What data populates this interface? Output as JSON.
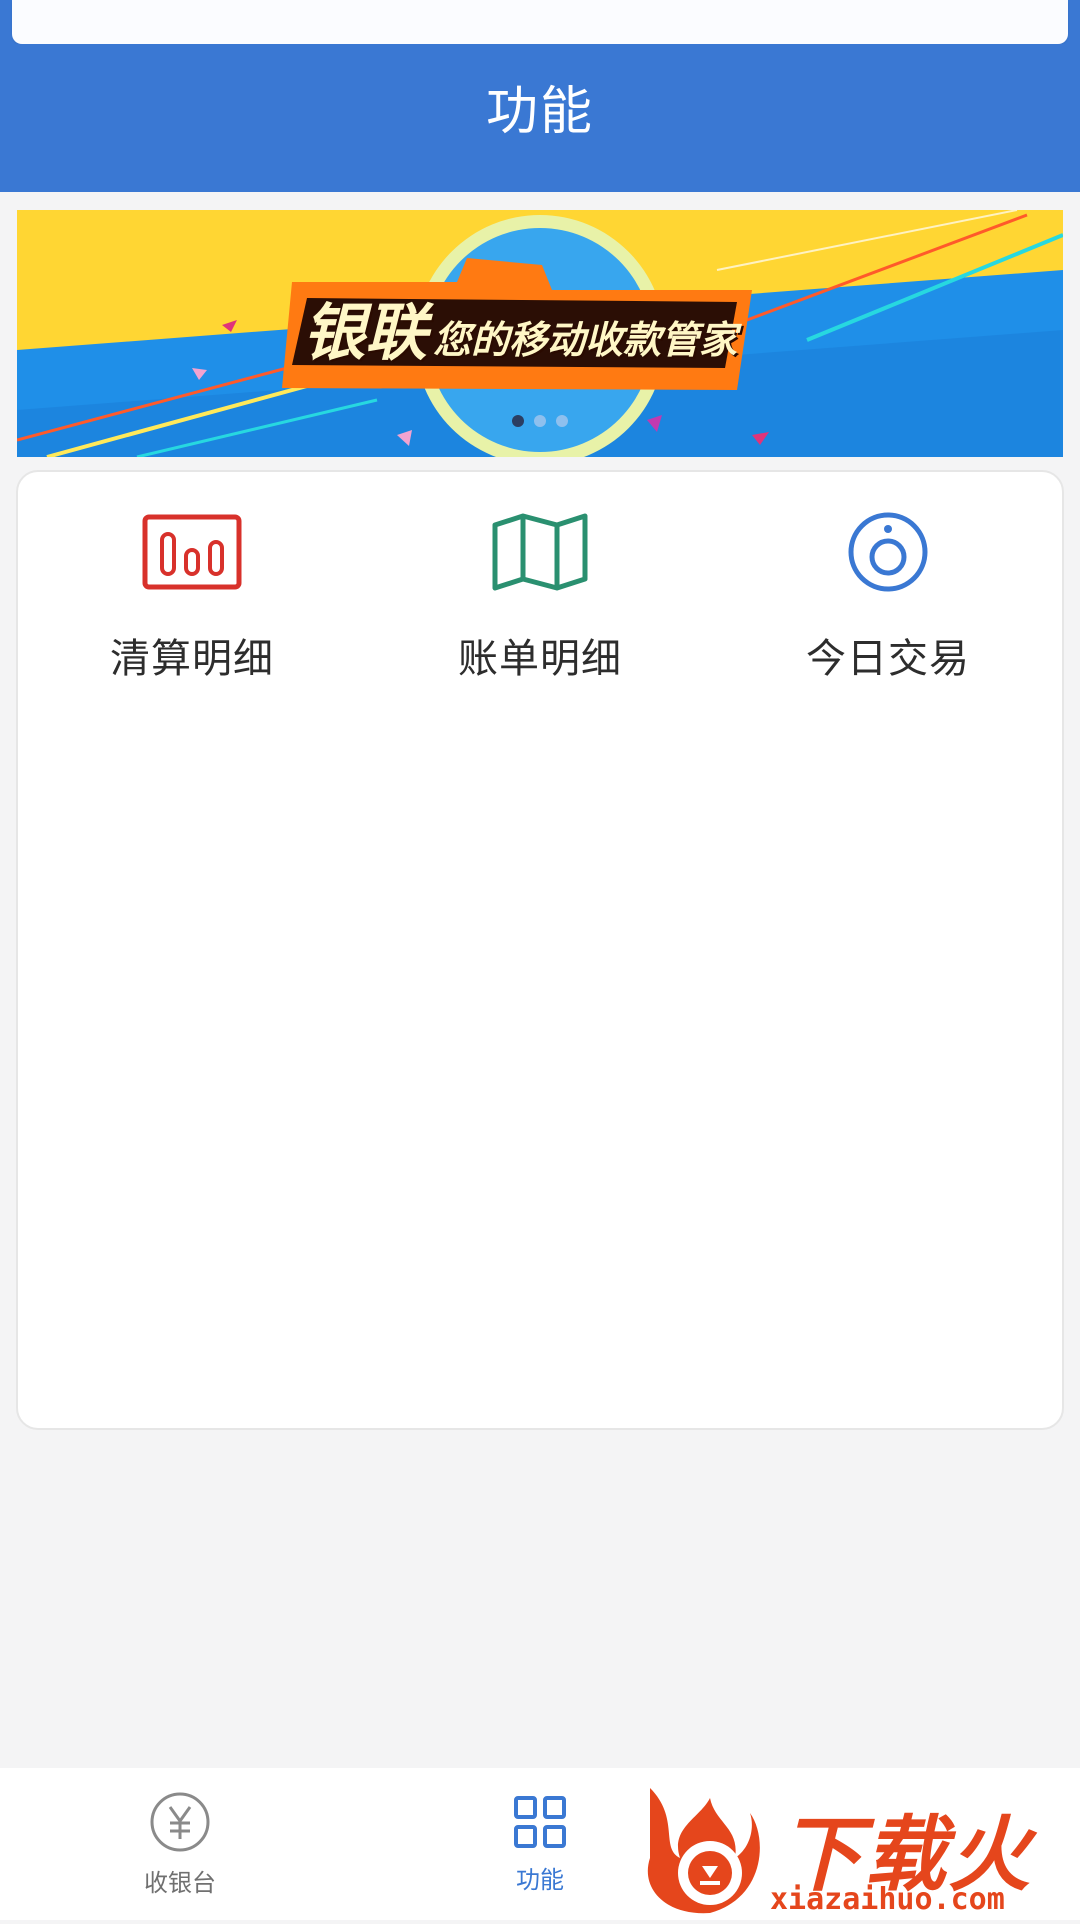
{
  "header": {
    "title": "功能"
  },
  "banner": {
    "brand": "银联",
    "slogan": "您的移动收款管家",
    "dots": 3,
    "active_dot": 0
  },
  "functions": [
    {
      "label": "清算明细",
      "icon": "bar-chart-icon",
      "color": "#d8312b"
    },
    {
      "label": "账单明细",
      "icon": "map-icon",
      "color": "#2a9070"
    },
    {
      "label": "今日交易",
      "icon": "target-icon",
      "color": "#3a78d3"
    }
  ],
  "tabbar": {
    "tabs": [
      {
        "label": "收银台",
        "icon": "yen-icon",
        "active": false
      },
      {
        "label": "功能",
        "icon": "grid-icon",
        "active": true
      }
    ]
  },
  "watermark": {
    "cn": "下载火",
    "en": "xiazaihuo.com"
  },
  "colors": {
    "primary": "#3a78d3",
    "background": "#f4f4f5"
  }
}
